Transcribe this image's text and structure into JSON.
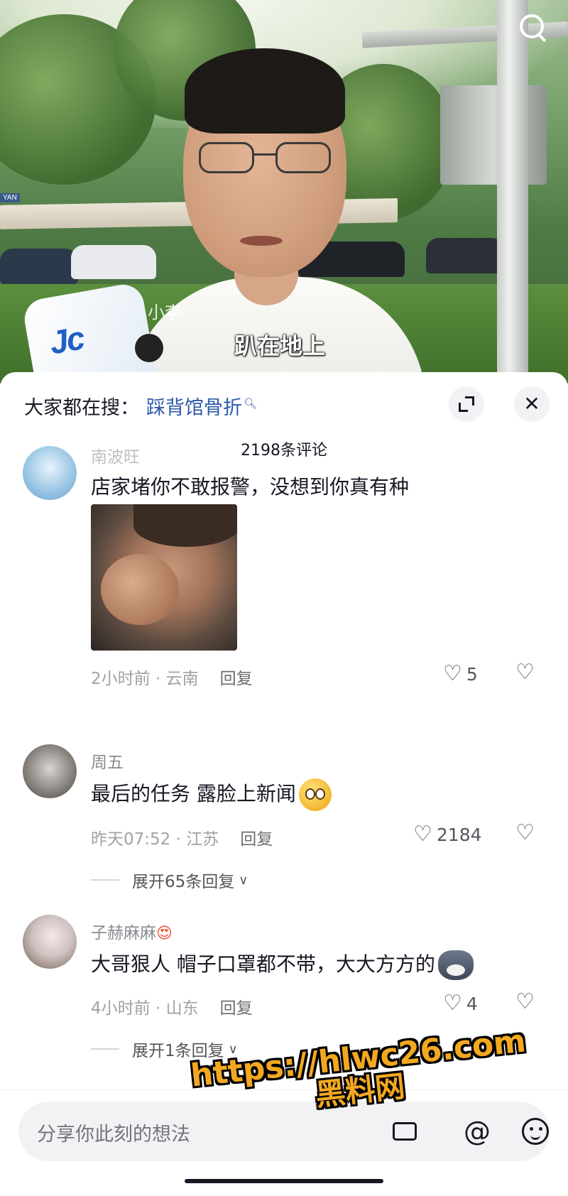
{
  "video": {
    "name_overlay": "小李",
    "subtitle": "趴在地上",
    "mic_logo": "Jc",
    "sign_text": "YAN"
  },
  "sheet": {
    "search_prefix": "大家都在搜：",
    "search_keyword": "踩背馆骨折",
    "comment_count": "2198条评论"
  },
  "comments": [
    {
      "username": "南波旺",
      "text": "店家堵你不敢报警，没想到你真有种",
      "has_image": true,
      "time_location": "2小时前 · 云南",
      "reply": "回复",
      "likes": "5"
    },
    {
      "username": "周五",
      "text": "最后的任务 露脸上新闻",
      "emoji": "smile-emoji",
      "time_location": "昨天07:52 · 江苏",
      "reply": "回复",
      "likes": "2184",
      "expand": "展开65条回复"
    },
    {
      "username": "子赫麻麻",
      "username_emoji": "😍",
      "text": "大哥狠人 帽子口罩都不带，大大方方的",
      "emoji": "dog-emoji",
      "time_location": "4小时前 · 山东",
      "reply": "回复",
      "likes": "4",
      "expand": "展开1条回复"
    }
  ],
  "input": {
    "placeholder": "分享你此刻的想法"
  },
  "watermark": {
    "line1": "https://hlwc26.com",
    "line2": "黑料网"
  },
  "colors": {
    "keyword": "#2e5aa8",
    "watermark": "#f2a81f",
    "text_primary": "#161823",
    "text_secondary": "#a0a1a7"
  },
  "icons": [
    "search-icon",
    "expand-icon",
    "close-icon",
    "heart-icon",
    "dislike-icon",
    "image-icon",
    "at-icon",
    "emoji-icon",
    "chevron-down-icon"
  ]
}
